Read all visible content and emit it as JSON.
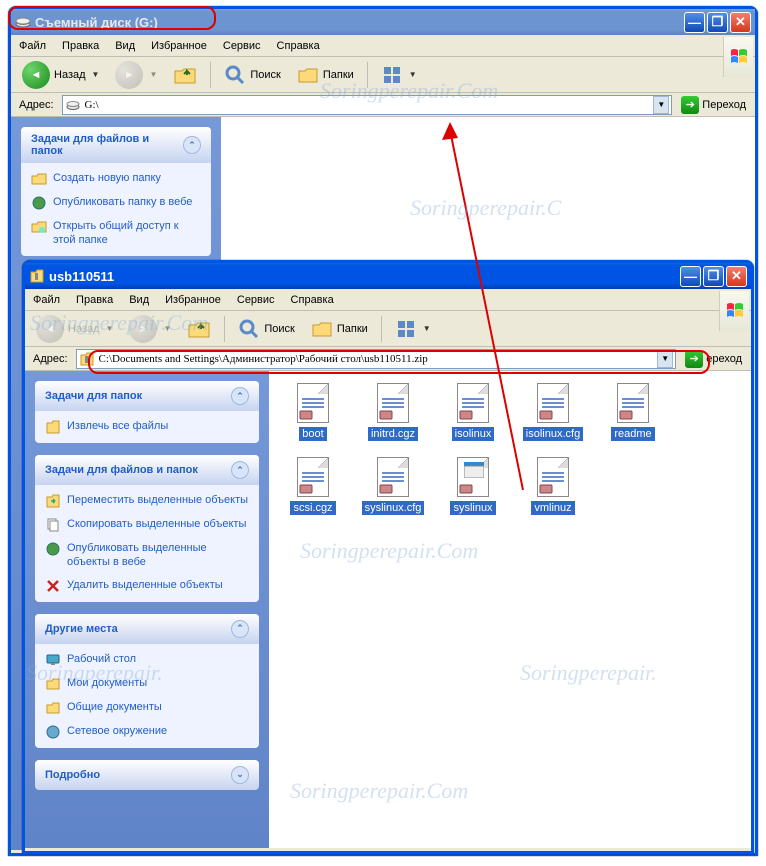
{
  "window1": {
    "title": "Съемный диск (G:)",
    "menus": [
      "Файл",
      "Правка",
      "Вид",
      "Избранное",
      "Сервис",
      "Справка"
    ],
    "toolbar": {
      "back": "Назад",
      "search": "Поиск",
      "folders": "Папки"
    },
    "addr_label": "Адрес:",
    "addr_value": "G:\\",
    "go": "Переход",
    "panels": {
      "tasks": {
        "title": "Задачи для файлов и папок",
        "items": [
          "Создать новую папку",
          "Опубликовать папку в вебе",
          "Открыть общий доступ к этой папке"
        ]
      }
    }
  },
  "window2": {
    "title": "usb110511",
    "menus": [
      "Файл",
      "Правка",
      "Вид",
      "Избранное",
      "Сервис",
      "Справка"
    ],
    "toolbar": {
      "back": "Назад",
      "search": "Поиск",
      "folders": "Папки"
    },
    "addr_label": "Адрес:",
    "addr_value": "C:\\Documents and Settings\\Администратор\\Рабочий стол\\usb110511.zip",
    "go": "ереход",
    "panels": {
      "folder_tasks": {
        "title": "Задачи для папок",
        "items": [
          "Извлечь все файлы"
        ]
      },
      "file_tasks": {
        "title": "Задачи для файлов и папок",
        "items": [
          "Переместить выделенные объекты",
          "Скопировать выделенные объекты",
          "Опубликовать выделенные объекты в вебе",
          "Удалить выделенные объекты"
        ]
      },
      "other": {
        "title": "Другие места",
        "items": [
          "Рабочий стол",
          "Мои документы",
          "Общие документы",
          "Сетевое окружение"
        ]
      },
      "details": {
        "title": "Подробно"
      }
    },
    "files": [
      "boot",
      "initrd.cgz",
      "isolinux",
      "isolinux.cfg",
      "readme",
      "scsi.cgz",
      "syslinux.cfg",
      "syslinux",
      "vmlinuz"
    ]
  }
}
